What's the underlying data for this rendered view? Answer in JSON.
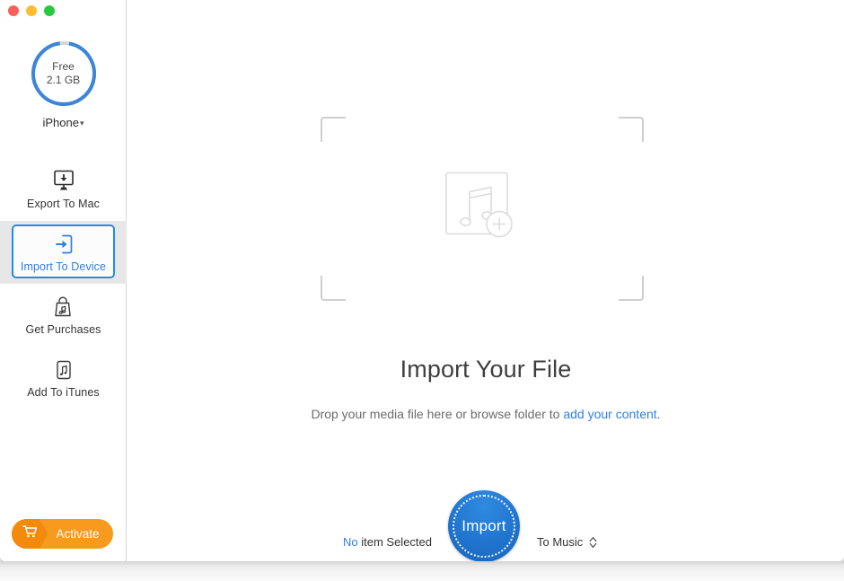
{
  "window": {
    "traffic_lights": [
      {
        "name": "close",
        "color": "#ff5f57"
      },
      {
        "name": "minimize",
        "color": "#febc2e"
      },
      {
        "name": "maximize",
        "color": "#28c840"
      }
    ]
  },
  "sidebar": {
    "storage": {
      "free_label": "Free",
      "free_value": "2.1 GB",
      "used_percent": 95,
      "ring_color": "#3d85d8",
      "track_color": "#d6d6d6"
    },
    "device": {
      "name": "iPhone",
      "chevron": "chevron-down-icon"
    },
    "items": [
      {
        "label": "Export To Mac",
        "icon": "monitor-download-icon",
        "selected": false
      },
      {
        "label": "Import To Device",
        "icon": "device-import-arrow-icon",
        "selected": true
      },
      {
        "label": "Get Purchases",
        "icon": "shopping-bag-music-icon",
        "selected": false
      },
      {
        "label": "Add To iTunes",
        "icon": "square-music-note-icon",
        "selected": false
      }
    ],
    "activate": {
      "label": "Activate",
      "icon": "shopping-cart-icon",
      "color": "#f79a1e"
    }
  },
  "main": {
    "dropzone": {
      "icon": "music-file-add-icon",
      "bracket_color": "#cfcfcf"
    },
    "headline": "Import Your File",
    "subline_prefix": "Drop your media file here or browse folder to ",
    "subline_link": "add your content",
    "subline_suffix": ".",
    "link_color": "#2f7fe0"
  },
  "bottom_bar": {
    "selection_count": "No",
    "selection_text": " item Selected",
    "import_button": "Import",
    "destination": "To Music",
    "destination_stepper": "chevron-up-down-icon"
  }
}
